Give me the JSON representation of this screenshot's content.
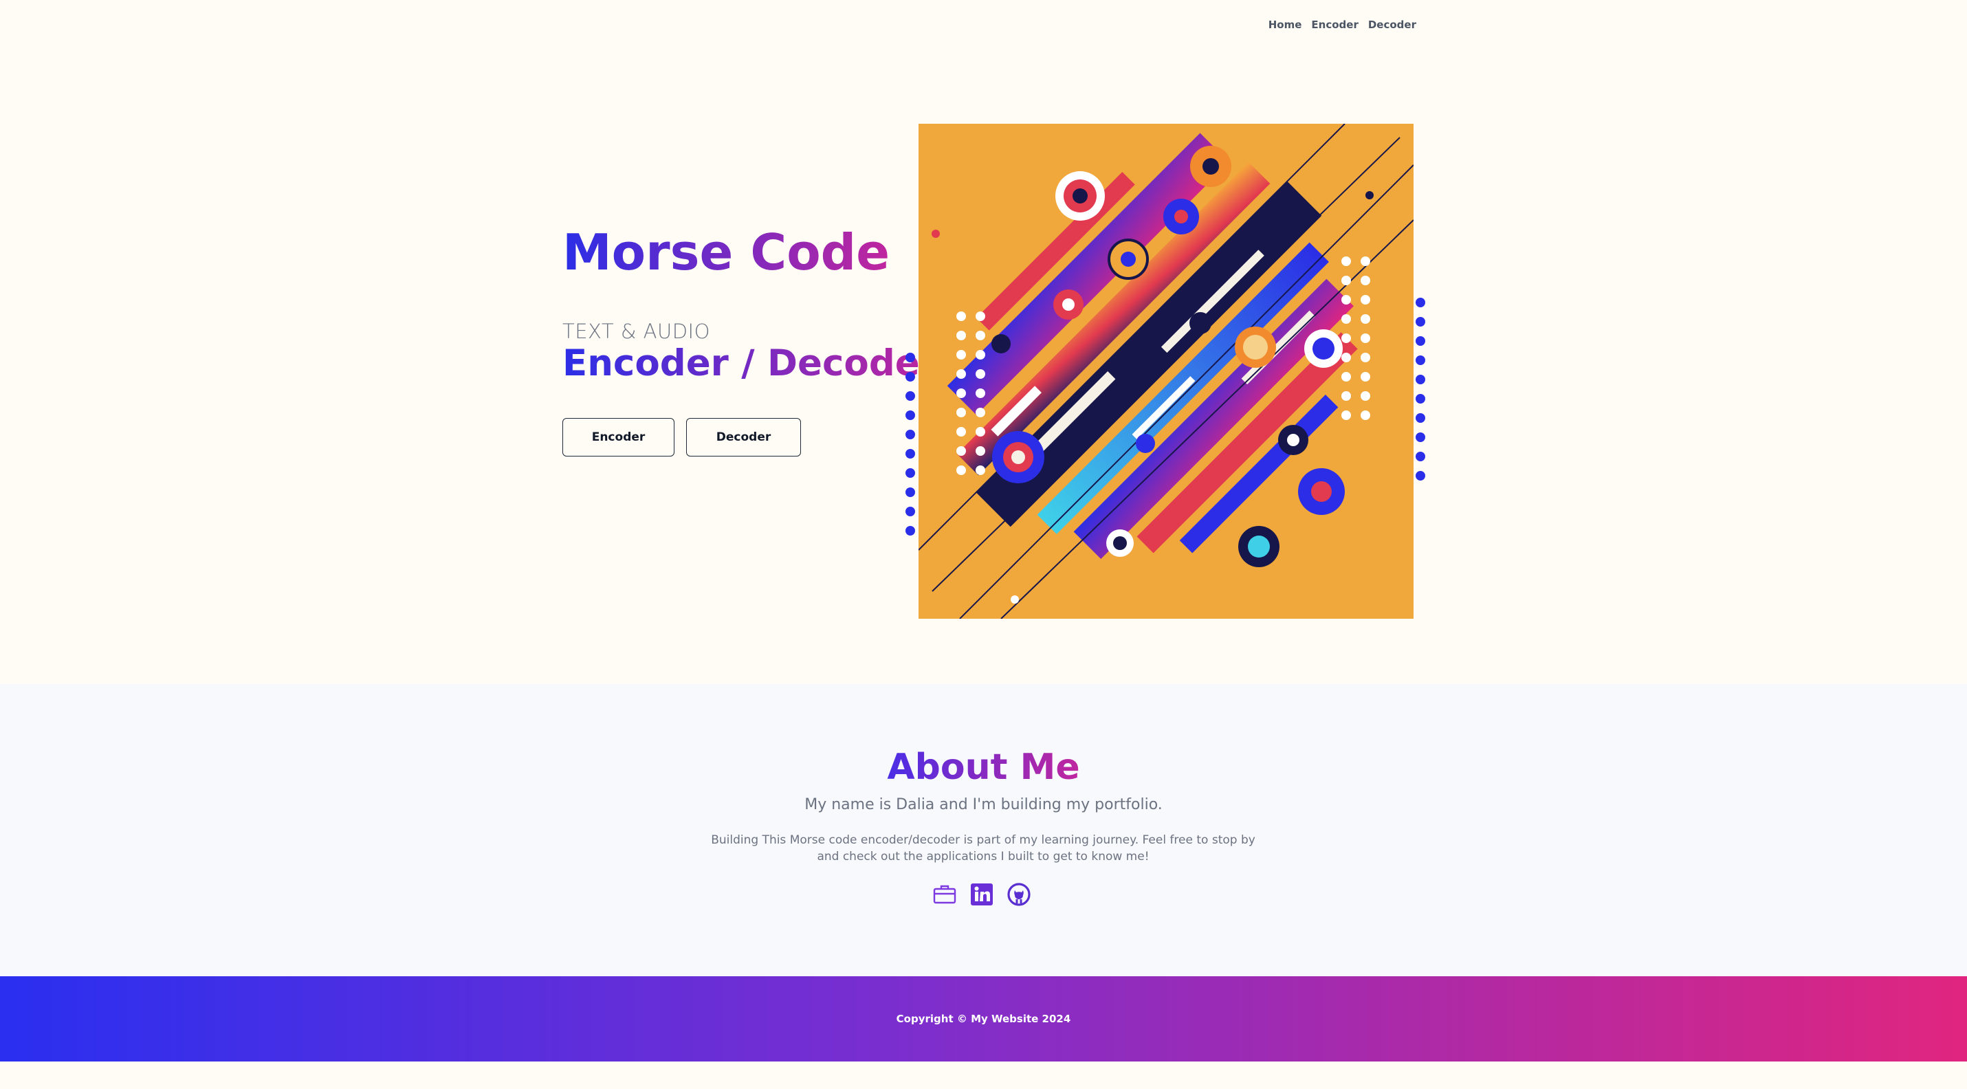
{
  "nav": {
    "items": [
      "Home",
      "Encoder",
      "Decoder"
    ]
  },
  "hero": {
    "title": "Morse Code",
    "kicker": "TEXT & AUDIO",
    "subtitle": "Encoder / Decoder",
    "buttons": {
      "encoder": "Encoder",
      "decoder": "Decoder"
    },
    "artwork_icon": "abstract-geometric-art"
  },
  "about": {
    "title": "About Me",
    "lead": "My name is Dalia and I'm building my portfolio.",
    "body": "Building This Morse code encoder/decoder is part of my learning journey. Feel free to stop by and check out the applications I built to get to know me!",
    "links": [
      "briefcase-icon",
      "linkedin-icon",
      "github-icon"
    ]
  },
  "footer": {
    "copyright": "Copyright © My Website 2024"
  },
  "colors": {
    "brand_blue": "#2b2ee6",
    "brand_magenta": "#c0269e",
    "art_orange": "#f0a73b",
    "dot_blue": "#2a2ee8"
  }
}
